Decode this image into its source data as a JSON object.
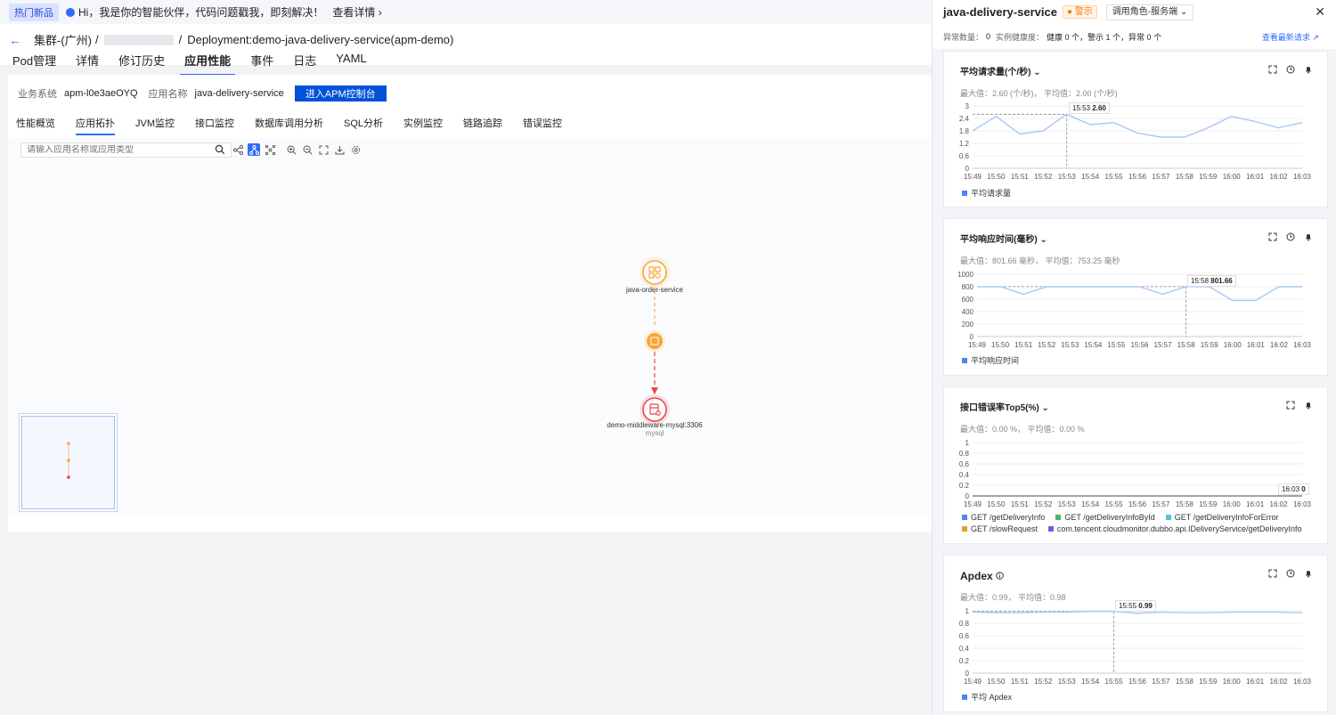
{
  "promo": {
    "badge": "热门新品",
    "text": "Hi，我是你的智能伙伴，代码问题戳我，即刻解决！",
    "link": "查看详情"
  },
  "header": {
    "cluster": "集群-(广州)",
    "separator1": "/",
    "separator2": "/",
    "deployment": "Deployment:demo-java-delivery-service(apm-demo)",
    "tabs": [
      {
        "label": "Pod管理"
      },
      {
        "label": "详情"
      },
      {
        "label": "修订历史"
      },
      {
        "label": "应用性能"
      },
      {
        "label": "事件"
      },
      {
        "label": "日志"
      },
      {
        "label": "YAML"
      }
    ]
  },
  "app_info": {
    "system_label": "业务系统",
    "system_value": "apm-l0e3aeOYQ",
    "app_label": "应用名称",
    "app_value": "java-delivery-service",
    "apm_button": "进入APM控制台"
  },
  "subtabs": [
    {
      "label": "性能概览"
    },
    {
      "label": "应用拓扑"
    },
    {
      "label": "JVM监控"
    },
    {
      "label": "接口监控"
    },
    {
      "label": "数据库调用分析"
    },
    {
      "label": "SQL分析"
    },
    {
      "label": "实例监控"
    },
    {
      "label": "链路追踪"
    },
    {
      "label": "错误监控"
    }
  ],
  "topology": {
    "search_placeholder": "请输入应用名称或应用类型",
    "nodes": [
      {
        "name": "java-order-service",
        "type": ""
      },
      {
        "name": "",
        "type": ""
      },
      {
        "name": "demo-middleware-mysql:3306",
        "type": "mysql"
      }
    ],
    "colors": {
      "normal": "#f7a53a",
      "error": "#e5474a"
    }
  },
  "drawer": {
    "service": "java-delivery-service",
    "status": "警示",
    "role_select": "调用角色-服务端",
    "stat": {
      "abnormal_label": "异常数量：",
      "abnormal_value": "0",
      "health_label": "实例健康度：",
      "health_value": "健康 0 个，警示 1 个，异常 0 个"
    },
    "latest_link": "查看最新请求",
    "cards": [
      {
        "title": "平均请求量(个/秒)",
        "summary": "最大值：2.60 (个/秒)， 平均值：2.00 (个/秒)",
        "tooltip_time": "15:53",
        "tooltip_value": "2.60",
        "legend": [
          "平均请求量"
        ]
      },
      {
        "title": "平均响应时间(毫秒)",
        "summary": "最大值：801.66 毫秒， 平均值：753.25 毫秒",
        "tooltip_time": "15:58",
        "tooltip_value": "801.66",
        "legend": [
          "平均响应时间"
        ]
      },
      {
        "title": "接口错误率Top5(%)",
        "summary": "最大值：0.00 %， 平均值：0.00 %",
        "tooltip_time": "16:03",
        "tooltip_value": "0",
        "legend": [
          "GET /getDeliveryInfo",
          "GET /getDeliveryInfoById",
          "GET /getDeliveryInfoForError",
          "GET /slowRequest",
          "com.tencent.cloudmonitor.dubbo.api.IDeliveryService/getDeliveryInfo"
        ]
      },
      {
        "title": "Apdex",
        "summary": "最大值：0.99， 平均值：0.98",
        "tooltip_time": "15:55",
        "tooltip_value": "0.99",
        "legend": [
          "平均 Apdex"
        ]
      }
    ]
  },
  "chart_data": [
    {
      "type": "line",
      "x": [
        "15:49",
        "15:50",
        "15:51",
        "15:52",
        "15:53",
        "15:54",
        "15:55",
        "15:56",
        "15:57",
        "15:58",
        "15:59",
        "16:00",
        "16:01",
        "16:02",
        "16:03"
      ],
      "series": [
        {
          "name": "平均请求量",
          "values": [
            1.8,
            2.5,
            1.65,
            1.8,
            2.6,
            2.1,
            2.2,
            1.7,
            1.5,
            1.5,
            1.95,
            2.5,
            2.25,
            1.95,
            2.2
          ]
        }
      ],
      "yticks": [
        0,
        0.6,
        1.2,
        1.8,
        2.4,
        3
      ],
      "ylim": [
        0,
        3
      ],
      "color": "#a6c8f8"
    },
    {
      "type": "line",
      "x": [
        "15:49",
        "15:50",
        "15:51",
        "15:52",
        "15:53",
        "15:54",
        "15:55",
        "15:56",
        "15:57",
        "15:58",
        "15:59",
        "16:00",
        "16:01",
        "16:02",
        "16:03"
      ],
      "series": [
        {
          "name": "平均响应时间",
          "values": [
            800,
            800,
            680,
            800,
            800,
            800,
            800,
            800,
            680,
            801.66,
            800,
            580,
            580,
            800,
            800
          ]
        }
      ],
      "yticks": [
        0,
        200,
        400,
        600,
        800,
        1000
      ],
      "ylim": [
        0,
        1000
      ],
      "color": "#a6c8f8"
    },
    {
      "type": "line",
      "x": [
        "15:49",
        "15:50",
        "15:51",
        "15:52",
        "15:53",
        "15:54",
        "15:55",
        "15:56",
        "15:57",
        "15:58",
        "15:59",
        "16:00",
        "16:01",
        "16:02",
        "16:03"
      ],
      "series": [
        {
          "name": "GET /getDeliveryInfo",
          "values": [
            0,
            0,
            0,
            0,
            0,
            0,
            0,
            0,
            0,
            0,
            0,
            0,
            0,
            0,
            0
          ]
        },
        {
          "name": "GET /getDeliveryInfoById",
          "values": [
            0,
            0,
            0,
            0,
            0,
            0,
            0,
            0,
            0,
            0,
            0,
            0,
            0,
            0,
            0
          ]
        },
        {
          "name": "GET /getDeliveryInfoForError",
          "values": [
            0,
            0,
            0,
            0,
            0,
            0,
            0,
            0,
            0,
            0,
            0,
            0,
            0,
            0,
            0
          ]
        },
        {
          "name": "GET /slowRequest",
          "values": [
            0,
            0,
            0,
            0,
            0,
            0,
            0,
            0,
            0,
            0,
            0,
            0,
            0,
            0,
            0
          ]
        },
        {
          "name": "com.tencent.cloudmonitor.dubbo.api.IDeliveryService/getDeliveryInfo",
          "values": [
            0,
            0,
            0,
            0,
            0,
            0,
            0,
            0,
            0,
            0,
            0,
            0,
            0,
            0,
            0
          ]
        }
      ],
      "yticks": [
        0,
        0.2,
        0.4,
        0.6,
        0.8,
        1
      ],
      "ylim": [
        0,
        1
      ],
      "color": "#9aa3b4"
    },
    {
      "type": "line",
      "x": [
        "15:49",
        "15:50",
        "15:51",
        "15:52",
        "15:53",
        "15:54",
        "15:55",
        "15:56",
        "15:57",
        "15:58",
        "15:59",
        "16:00",
        "16:01",
        "16:02",
        "16:03"
      ],
      "series": [
        {
          "name": "平均 Apdex",
          "values": [
            0.98,
            0.97,
            0.97,
            0.98,
            0.98,
            0.99,
            0.99,
            0.96,
            0.98,
            0.97,
            0.97,
            0.98,
            0.98,
            0.98,
            0.97
          ]
        }
      ],
      "yticks": [
        0,
        0.2,
        0.4,
        0.6,
        0.8,
        1
      ],
      "ylim": [
        0,
        1
      ],
      "color": "#a6c8f8"
    }
  ],
  "legend_colors": [
    "#4a86f7",
    "#4ab56a",
    "#52c4d9",
    "#e0a32e",
    "#6a5ee0"
  ]
}
